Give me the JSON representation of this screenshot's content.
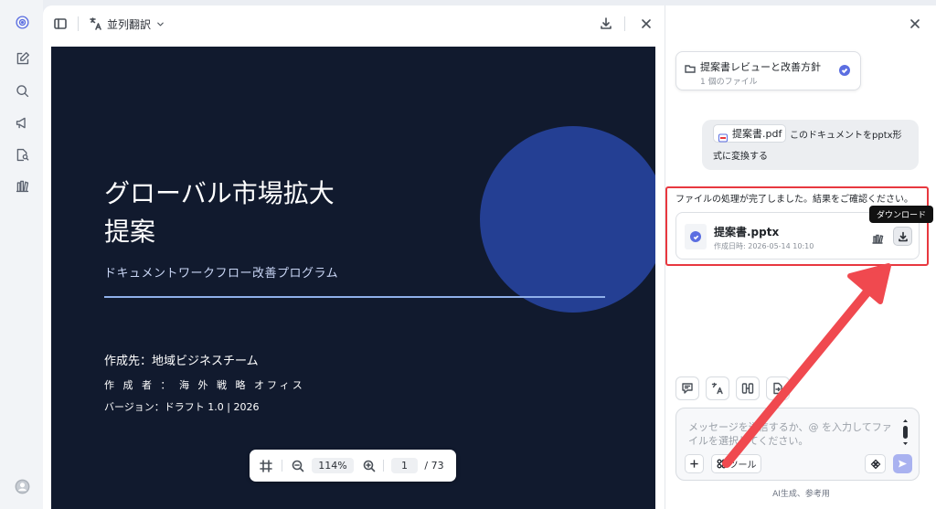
{
  "toolbar": {
    "translate_label": "並列翻訳"
  },
  "slide": {
    "title_line1": "グローバル市場拡大",
    "title_line2": "提案",
    "subtitle": "ドキュメントワークフロー改善プログラム",
    "meta1": "作成先：地域ビジネスチーム",
    "meta2": "作 成 者 ： 海 外 戦 略 オフィス",
    "meta3": "バージョン：ドラフト 1.0 | 2026"
  },
  "zoom": {
    "level": "114%",
    "page": "1",
    "total": "/ 73"
  },
  "chat": {
    "task_title": "提案書レビューと改善方針",
    "task_subtitle": "1 個のファイル",
    "attached_file": "提案書.pdf",
    "user_msg_line1": "このドキュメントをpptx形",
    "user_msg_line2": "式に変換する",
    "response": "ファイルの処理が完了しました。結果をご確認ください。",
    "result_file": "提案書.pptx",
    "result_date": "作成日時: 2026-05-14 10:10",
    "tooltip": "ダウンロード",
    "input_placeholder": "メッセージを送信するか、@ を入力してファイルを選択してください。",
    "tools_label": "ツール",
    "footer": "AI生成、参考用"
  },
  "colors": {
    "slide_bg": "#111a2e",
    "slide_circle": "#243f93",
    "accent": "#5b6ee1",
    "annotation": "#e8383f"
  }
}
